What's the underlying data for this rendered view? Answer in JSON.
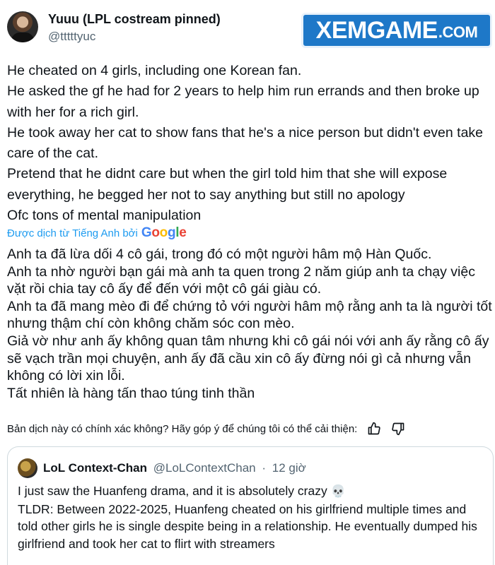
{
  "author": {
    "display_name": "Yuuu (LPL costream pinned)",
    "handle": "@tttttyuc"
  },
  "watermark": {
    "main": "XEMGAME",
    "suffix": ".COM"
  },
  "post": {
    "english_lines": [
      "He cheated on 4 girls, including one Korean fan.",
      "He asked the gf he had for 2 years to help him run errands and then broke up with her for a rich girl.",
      "He took away her cat to show fans that he's a nice person but didn't even take care of the cat.",
      "Pretend that he didnt care but when the girl told him that she will expose everything, he begged her not to say anything but still no apology",
      "Ofc tons of mental manipulation"
    ],
    "translated_by_label": "Được dịch từ Tiếng Anh bởi",
    "translator": "Google",
    "vietnamese_lines": [
      "Anh ta đã lừa dối 4 cô gái, trong đó có một người hâm mộ Hàn Quốc.",
      "Anh ta nhờ người bạn gái mà anh ta quen trong 2 năm giúp anh ta chạy việc vặt rồi chia tay cô ấy để đến với một cô gái giàu có.",
      "Anh ta đã mang mèo đi để chứng tỏ với người hâm mộ rằng anh ta là người tốt nhưng thậm chí còn không chăm sóc con mèo.",
      "Giả vờ như anh ấy không quan tâm nhưng khi cô gái nói với anh ấy rằng cô ấy sẽ vạch trần mọi chuyện, anh ấy đã cầu xin cô ấy đừng nói gì cả nhưng vẫn không có lời xin lỗi.",
      "Tất nhiên là hàng tấn thao túng tinh thần"
    ],
    "feedback_question": "Bản dịch này có chính xác không? Hãy góp ý để chúng tôi có thể cải thiện:"
  },
  "quoted": {
    "display_name": "LoL Context-Chan",
    "handle": "@LoLContextChan",
    "separator": "·",
    "time": "12 giờ",
    "line1": "I just saw the Huanfeng drama, and it is absolutely crazy",
    "line1_emoji": "💀",
    "line2": "TLDR: Between 2022-2025, Huanfeng cheated on his girlfriend multiple times and told other girls he is single despite being in a relationship. He eventually dumped his girlfriend and took her cat to flirt with streamers"
  },
  "icons": [
    "thumbs-up-icon",
    "thumbs-down-icon"
  ],
  "colors": {
    "link_blue": "#1d9bf0",
    "text": "#0f1419",
    "muted": "#536471",
    "watermark_bg": "#1e78c8"
  }
}
